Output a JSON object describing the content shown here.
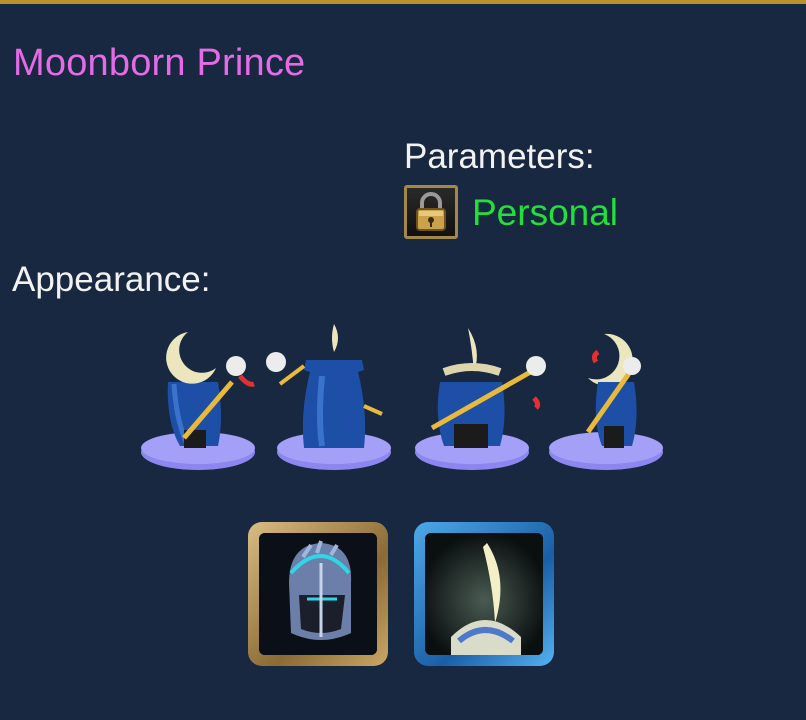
{
  "unit": {
    "name": "Moonborn Prince",
    "name_color": "#e56be6"
  },
  "parameters": {
    "label": "Parameters:",
    "lock_icon": "padlock-icon",
    "value": "Personal",
    "value_color": "#22e03a"
  },
  "appearance": {
    "label": "Appearance:",
    "poses": [
      {
        "name": "front-left"
      },
      {
        "name": "back"
      },
      {
        "name": "front"
      },
      {
        "name": "side-right"
      }
    ]
  },
  "skins": [
    {
      "icon": "knight-helmet-icon",
      "frame": "gold"
    },
    {
      "icon": "crescent-moon-helmet-icon",
      "frame": "blue"
    }
  ],
  "colors": {
    "panel_background": "#172840",
    "panel_border": "#b8922e",
    "pedestal": "#8c86f0"
  }
}
